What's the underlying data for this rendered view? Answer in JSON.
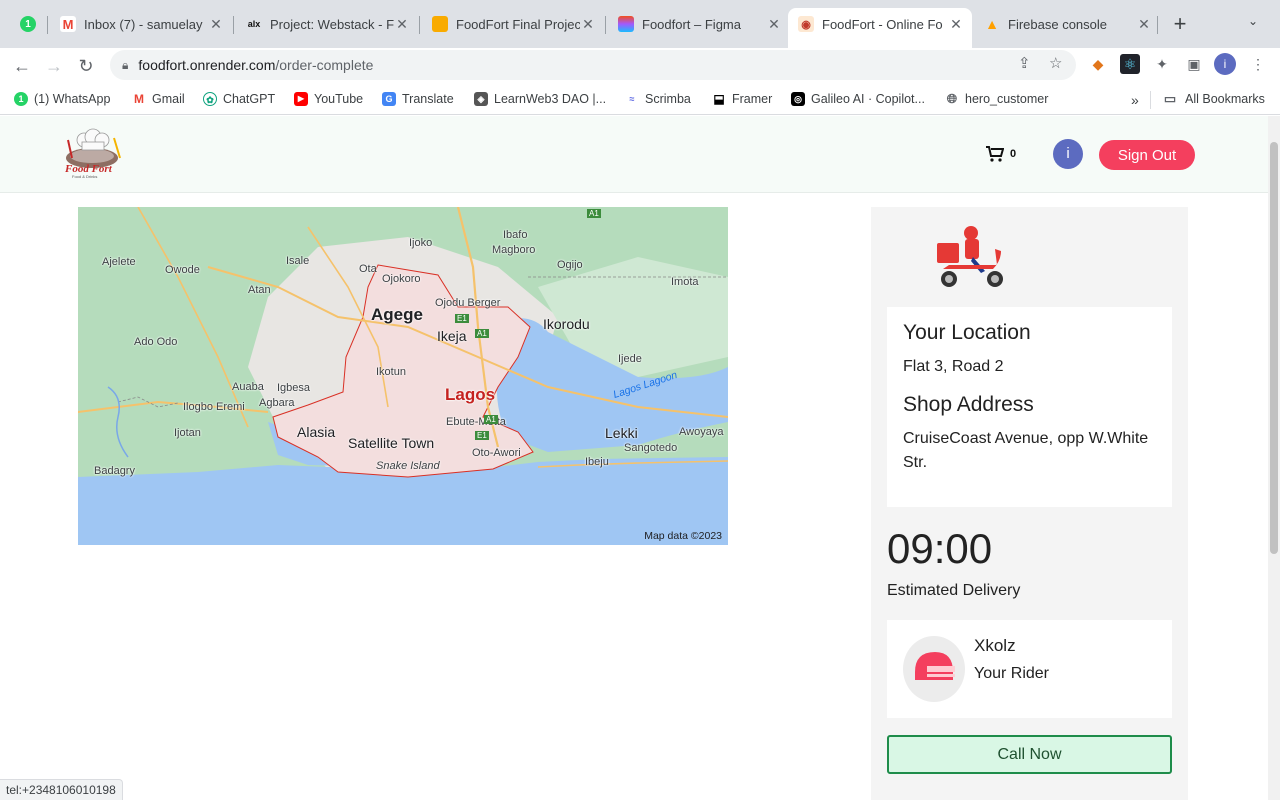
{
  "browser": {
    "tabs": [
      {
        "title": "",
        "favicon": "whatsapp-badge",
        "badge": "1"
      },
      {
        "title": "Inbox (7) - samuelay",
        "favicon": "gmail-icon"
      },
      {
        "title": "Project: Webstack - F",
        "favicon": "alx-icon"
      },
      {
        "title": "FoodFort Final Projec",
        "favicon": "slides-icon"
      },
      {
        "title": "Foodfort – Figma",
        "favicon": "figma-icon"
      },
      {
        "title": "FoodFort - Online Fo",
        "favicon": "foodfort-icon",
        "active": true
      },
      {
        "title": "Firebase console",
        "favicon": "firebase-icon"
      }
    ],
    "url_host": "foodfort.onrender.com",
    "url_path": "/order-complete",
    "profile_initial": "i",
    "bookmarks": [
      {
        "label": "(1) WhatsApp",
        "icon": "whatsapp-icon"
      },
      {
        "label": "Gmail",
        "icon": "gmail-icon"
      },
      {
        "label": "ChatGPT",
        "icon": "chatgpt-icon"
      },
      {
        "label": "YouTube",
        "icon": "youtube-icon"
      },
      {
        "label": "Translate",
        "icon": "translate-icon"
      },
      {
        "label": "LearnWeb3 DAO |...",
        "icon": "learnweb3-icon"
      },
      {
        "label": "Scrimba",
        "icon": "scrimba-icon"
      },
      {
        "label": "Framer",
        "icon": "framer-icon"
      },
      {
        "label": "Galileo AI · Copilot...",
        "icon": "galileo-icon"
      },
      {
        "label": "hero_customer",
        "icon": "globe-icon"
      }
    ],
    "bookmarks_more": "»",
    "all_bookmarks": "All Bookmarks",
    "status_url": "tel:+2348106010198"
  },
  "site": {
    "brand_name": "Food Fort",
    "brand_tagline": "Food & Drinks",
    "cart_count": "0",
    "avatar_initial": "i",
    "sign_out": "Sign Out"
  },
  "map": {
    "credit": "Map data ©2023",
    "labels": [
      "Ijoko",
      "Ibafo",
      "Magboro",
      "Ogijo",
      "Ajelete",
      "Owode",
      "Isale",
      "Ota",
      "Ojokoro",
      "Ojodu Berger",
      "Imota",
      "Atan",
      "Agege",
      "Ikeja",
      "Ikorodu",
      "Ado Odo",
      "Ijede",
      "Ikotun",
      "Auaba",
      "Igbesa",
      "Agbara",
      "Ilogbo Eremi",
      "Lagos",
      "Lagos Lagoon",
      "Ijotan",
      "Alasia",
      "Ebute-Metta",
      "Satellite Town",
      "Lekki",
      "Awoyaya",
      "Oto-Awori",
      "Sangotedo",
      "Snake Island",
      "Ibeju",
      "Badagry"
    ],
    "road_shields": [
      "A1",
      "E1",
      "A1",
      "E1",
      "A1"
    ]
  },
  "order": {
    "location_title": "Your Location",
    "location_value": "Flat 3, Road 2",
    "shop_title": "Shop Address",
    "shop_value": "CruiseCoast Avenue, opp W.White Str.",
    "eta": "09:00",
    "eta_label": "Estimated Delivery",
    "rider_name": "Xkolz",
    "rider_role": "Your Rider",
    "call_button": "Call Now"
  },
  "colors": {
    "accent": "#f43f5e",
    "call_bg": "#d9f7e5",
    "call_border": "#1e8c4a",
    "avatar": "#5c6bc0"
  }
}
